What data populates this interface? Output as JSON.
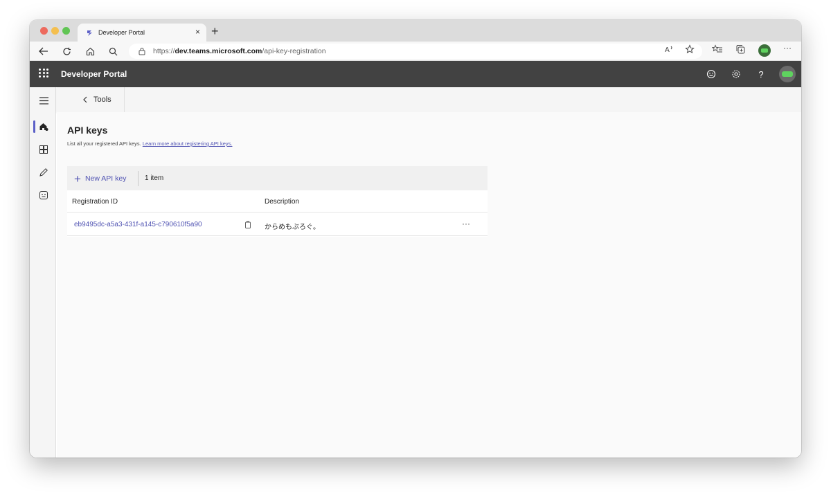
{
  "browser": {
    "tab_title": "Developer Portal",
    "tab_close": "×",
    "new_tab": "+",
    "url_scheme": "https://",
    "url_host": "dev.teams.microsoft.com",
    "url_path": "/api-key-registration",
    "more_label": "···"
  },
  "app": {
    "title": "Developer Portal",
    "help_label": "?"
  },
  "breadcrumb": {
    "back_label": "Tools"
  },
  "page": {
    "title": "API keys",
    "subtitle": "List all your registered API keys.",
    "learn_more": "Learn more about registering API keys."
  },
  "toolbar": {
    "new_label": "New API key",
    "count": "1 item"
  },
  "table": {
    "columns": [
      "Registration ID",
      "Description"
    ],
    "rows": [
      {
        "registration_id": "eb9495dc-a5a3-431f-a145-c790610f5a90",
        "description": "からめもぶろぐ。",
        "actions": "···"
      }
    ]
  },
  "colors": {
    "accent": "#5b5fc7",
    "link": "#4f52b2",
    "header_bg": "#424242"
  }
}
